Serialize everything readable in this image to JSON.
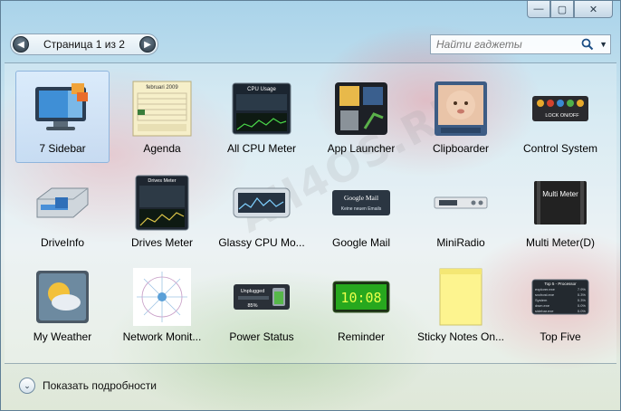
{
  "window": {
    "buttons": {
      "minimize": "—",
      "maximize": "▢",
      "close": "✕"
    }
  },
  "pager": {
    "label": "Страница 1 из 2",
    "prev": "◀",
    "next": "▶"
  },
  "search": {
    "placeholder": "Найти гаджеты",
    "dropdown": "▼"
  },
  "watermark": "All4OS.RU",
  "gadgets": [
    {
      "name": "7 Sidebar",
      "icon": "monitor-icon",
      "selected": true
    },
    {
      "name": "Agenda",
      "icon": "calendar-icon"
    },
    {
      "name": "All CPU Meter",
      "icon": "cpu-meter-icon"
    },
    {
      "name": "App Launcher",
      "icon": "app-launcher-icon"
    },
    {
      "name": "Clipboarder",
      "icon": "baby-photo-icon"
    },
    {
      "name": "Control System",
      "icon": "control-system-icon"
    },
    {
      "name": "DriveInfo",
      "icon": "drive-icon"
    },
    {
      "name": "Drives Meter",
      "icon": "drives-meter-icon"
    },
    {
      "name": "Glassy CPU Mo...",
      "icon": "glassy-cpu-icon"
    },
    {
      "name": "Google Mail",
      "icon": "mail-icon"
    },
    {
      "name": "MiniRadio",
      "icon": "radio-icon"
    },
    {
      "name": "Multi Meter(D)",
      "icon": "multi-meter-icon"
    },
    {
      "name": "My Weather",
      "icon": "weather-icon"
    },
    {
      "name": "Network Monit...",
      "icon": "network-icon"
    },
    {
      "name": "Power Status",
      "icon": "battery-icon"
    },
    {
      "name": "Reminder",
      "icon": "clock-icon"
    },
    {
      "name": "Sticky Notes On...",
      "icon": "sticky-note-icon"
    },
    {
      "name": "Top Five",
      "icon": "top-five-icon"
    }
  ],
  "thumb_text": {
    "agenda_month": "februari 2009",
    "cpu_title": "CPU Usage",
    "gmail_title": "Google Mail",
    "gmail_sub": "Keine neuen Emails",
    "lock": "LOCK ON/OFF",
    "drives_title": "Drives Meter",
    "multi_meter": "Multi Meter",
    "unplugged": "Unplugged",
    "battery_pct": "85%",
    "reminder_time": "10:08",
    "top5_title": "Top 5 - Processor",
    "top5_rows": [
      {
        "name": "explorer.exe",
        "val": "7.9%"
      },
      {
        "name": "svchost.exe",
        "val": "0.3%"
      },
      {
        "name": "System",
        "val": "0.3%"
      },
      {
        "name": "dwm.exe",
        "val": "0.0%"
      },
      {
        "name": "sidebar.exe",
        "val": "0.0%"
      }
    ]
  },
  "footer": {
    "label": "Показать подробности",
    "chevron": "⌄"
  }
}
